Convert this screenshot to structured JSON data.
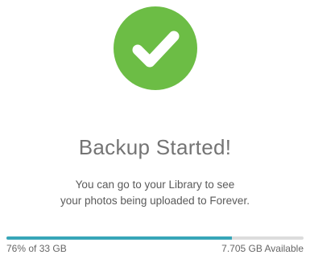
{
  "status": {
    "icon": "checkmark-icon",
    "title": "Backup Started!",
    "message_line1": "You can go to your Library to see",
    "message_line2": "your photos being uploaded to Forever."
  },
  "storage": {
    "used_label": "76% of 33 GB",
    "available_label": "7.705 GB Available",
    "used_fraction": 0.76
  },
  "colors": {
    "accent_green": "#6cbd45",
    "progress_fill": "#37a6b8",
    "progress_track": "#dcdcdc"
  }
}
